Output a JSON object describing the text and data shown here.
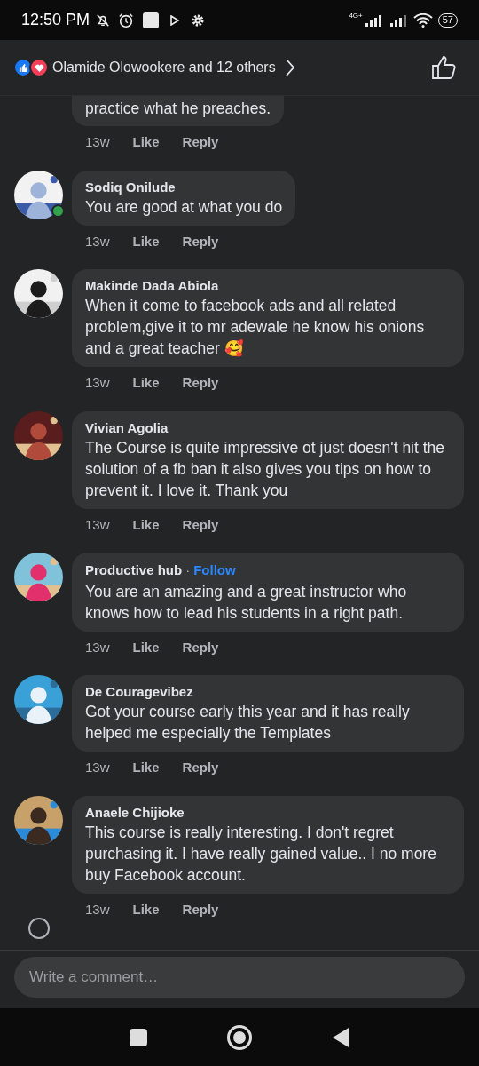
{
  "status_bar": {
    "time": "12:50 PM",
    "network": "4G+",
    "battery": "57"
  },
  "reactions_header": {
    "summary": "Olamide Olowookere and 12 others"
  },
  "comments": [
    {
      "text": "practice what he preaches.",
      "time": "13w",
      "like": "Like",
      "reply": "Reply",
      "online": false,
      "cut_top": true
    },
    {
      "author": "Sodiq Onilude",
      "text": "You are good at what you do",
      "time": "13w",
      "like": "Like",
      "reply": "Reply",
      "online": true,
      "cut_top": false
    },
    {
      "author": "Makinde Dada Abiola",
      "text": "When it come to facebook ads and all related problem,give it to mr adewale he know his onions and a great teacher 🥰",
      "time": "13w",
      "like": "Like",
      "reply": "Reply",
      "online": false,
      "cut_top": false
    },
    {
      "author": "Vivian Agolia",
      "text": "The Course is quite impressive ot just doesn't hit the solution of a fb ban it also gives you tips on how to prevent it. I love it. Thank you",
      "time": "13w",
      "like": "Like",
      "reply": "Reply",
      "online": false,
      "cut_top": false
    },
    {
      "author": "Productive hub",
      "separator": "·",
      "follow": "Follow",
      "text": "You are an amazing and a great instructor who knows how to lead his students in a right path.",
      "time": "13w",
      "like": "Like",
      "reply": "Reply",
      "online": false,
      "cut_top": false
    },
    {
      "author": "De Couragevibez",
      "text": "Got your course early this year and it has really helped me especially the Templates",
      "time": "13w",
      "like": "Like",
      "reply": "Reply",
      "online": false,
      "cut_top": false
    },
    {
      "author": "Anaele Chijioke",
      "text": "This course is really interesting. I don't regret purchasing it. I have really gained value.. I no more buy Facebook account.",
      "time": "13w",
      "like": "Like",
      "reply": "Reply",
      "online": false,
      "cut_top": false
    }
  ],
  "composer": {
    "placeholder": "Write a comment…"
  }
}
